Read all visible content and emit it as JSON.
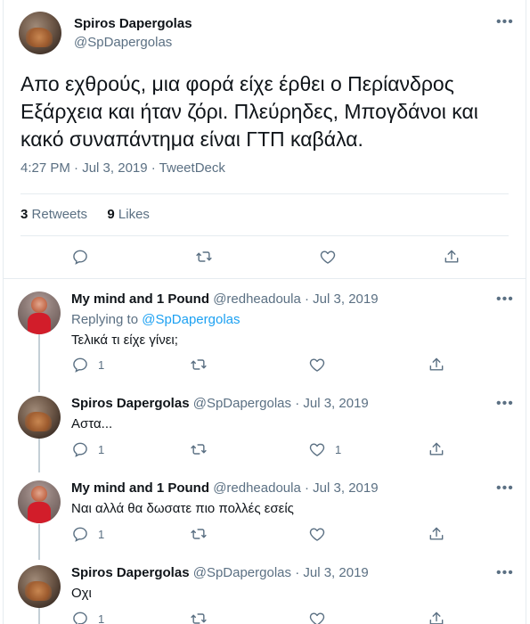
{
  "main_tweet": {
    "name": "Spiros Dapergolas",
    "handle": "@SpDapergolas",
    "text": "Απο εχθρούς, μια φορά είχε έρθει ο Περίανδρος Εξάρχεια και ήταν ζόρι. Πλεύρηδες, Μπογδάνοι και κακό συναπάντημα είναι ΓΤΠ καβάλα.",
    "time": "4:27 PM",
    "date": "Jul 3, 2019",
    "source": "TweetDeck",
    "separator": " · ",
    "retweets_count": "3",
    "retweets_label": "Retweets",
    "likes_count": "9",
    "likes_label": "Likes",
    "more_icon": "•••"
  },
  "replies": [
    {
      "name": "My mind and 1 Pound",
      "handle": "@redheadoula",
      "date": "Jul 3, 2019",
      "replying_to_label": "Replying to",
      "replying_to_handle": "@SpDapergolas",
      "text": "Τελικά τι είχε γίνει;",
      "reply_count": "1",
      "retweet_count": "",
      "like_count": ""
    },
    {
      "name": "Spiros Dapergolas",
      "handle": "@SpDapergolas",
      "date": "Jul 3, 2019",
      "text": "Αστα...",
      "reply_count": "1",
      "retweet_count": "",
      "like_count": "1"
    },
    {
      "name": "My mind and 1 Pound",
      "handle": "@redheadoula",
      "date": "Jul 3, 2019",
      "text": "Ναι αλλά θα δωσατε πιο πολλές εσείς",
      "reply_count": "1",
      "retweet_count": "",
      "like_count": ""
    },
    {
      "name": "Spiros Dapergolas",
      "handle": "@SpDapergolas",
      "date": "Jul 3, 2019",
      "text": "Οχι",
      "reply_count": "1",
      "retweet_count": "",
      "like_count": ""
    }
  ],
  "colors": {
    "text": "#0f1419",
    "secondary": "#5b7083",
    "link": "#1da1f2",
    "border": "#e6ecf0",
    "thread_line": "#c4cfd6"
  },
  "icons": {
    "reply": "reply-icon",
    "retweet": "retweet-icon",
    "like": "heart-icon",
    "share": "share-icon",
    "more": "more-icon"
  }
}
